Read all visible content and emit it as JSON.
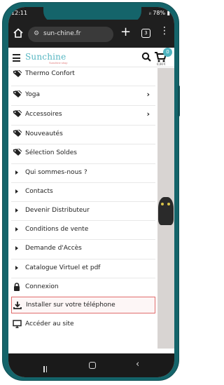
{
  "status_bar": {
    "time": "12:11",
    "battery": "78%"
  },
  "browser": {
    "url": "sun-chine.fr",
    "tab_count": "3"
  },
  "site": {
    "logo": "Sunchine",
    "logo_sub": "Sunchine shop",
    "cart_count": "0",
    "cart_price": "0,00 €"
  },
  "menu": {
    "items": [
      {
        "label": "Thermo Confort",
        "icon": "tag-icon",
        "chevron": false
      },
      {
        "label": "Yoga",
        "icon": "tag-icon",
        "chevron": true
      },
      {
        "label": "Accessoires",
        "icon": "tag-icon",
        "chevron": true
      },
      {
        "label": "Nouveautés",
        "icon": "tag-icon",
        "chevron": false
      },
      {
        "label": "Sélection Soldes",
        "icon": "tag-icon",
        "chevron": false
      },
      {
        "label": "Qui sommes-nous ?",
        "icon": "triangle-icon"
      },
      {
        "label": "Contacts",
        "icon": "triangle-icon"
      },
      {
        "label": "Devenir Distributeur",
        "icon": "triangle-icon"
      },
      {
        "label": "Conditions de vente",
        "icon": "triangle-icon"
      },
      {
        "label": "Demande d'Accès",
        "icon": "triangle-icon"
      },
      {
        "label": "Catalogue Virtuel et pdf",
        "icon": "triangle-icon"
      },
      {
        "label": "Connexion",
        "icon": "lock-icon"
      },
      {
        "label": "Installer sur votre téléphone",
        "icon": "download-icon"
      },
      {
        "label": "Accéder au site",
        "icon": "monitor-icon"
      }
    ]
  },
  "colors": {
    "frame": "#14646a",
    "accent": "#55b6c2",
    "highlight_border": "#e06c6c"
  }
}
